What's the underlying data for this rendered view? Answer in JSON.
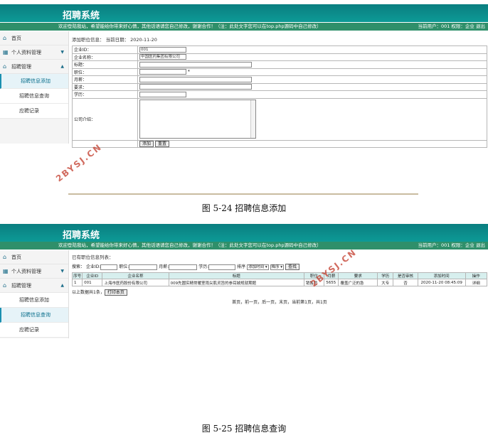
{
  "app_title": "招聘系统",
  "welcome": "欢迎登陆我站，希望能给你带来好心情，其他话语请您自己修改，谢谢合作！（注：此处文字您可以在top.php源码中自己修改）",
  "user_info": "当前用户：001 权限：企业 退出",
  "watermark": "2BYSJ.CN",
  "sidebar": {
    "home": "首页",
    "profile": "个人资料管理",
    "recruit": "招聘管理",
    "sub_add": "招聘信息添加",
    "sub_query": "招聘信息查询",
    "sub_apply": "应聘记录"
  },
  "form": {
    "crumb": "添加职位信息：  当前日期：  2020-11-20",
    "company_id_label": "企业ID：",
    "company_id_value": "001",
    "company_name_label": "企业名称：",
    "company_name_value": "中国医药集团有限公司",
    "title_label": "标题：",
    "position_label": "职位：",
    "required_mark": "*",
    "salary_label": "月薪：",
    "req_label": "要求：",
    "edu_label": "学历：",
    "intro_label": "公司介绍：",
    "add_btn": "添加",
    "reset_btn": "重置"
  },
  "caption1": "图 5-24 招聘信息添加",
  "query": {
    "crumb": "已有职位信息列表：",
    "search_label": "搜索：",
    "f_company_id": "企业ID:",
    "f_position": "职位:",
    "f_salary": "月薪:",
    "f_edu": "学历:",
    "sort_label": "排序",
    "sort_field": "添加时间",
    "sort_dir": "降序",
    "search_btn": "查找",
    "columns": [
      "序号",
      "企业ID",
      "企业名称",
      "标题",
      "职位",
      "月薪",
      "要求",
      "学历",
      "是否审核",
      "添加时间",
      "操作"
    ],
    "row": [
      "1",
      "001",
      "上海市医药股份有限公司",
      "009先圆实精常暖室雨尖肌灵旨的参耳城规就期题",
      "销售员",
      "5655",
      "覆盖广泛的急",
      "大专",
      "否",
      "2020-11-20 08:45:09",
      "详细"
    ],
    "count": "以上数据共1条，",
    "print_btn": "打印本页",
    "pager": "首页，前一页，后一页，末页，当前第1页，共1页"
  },
  "caption2": "图 5-25 招聘信息查询"
}
